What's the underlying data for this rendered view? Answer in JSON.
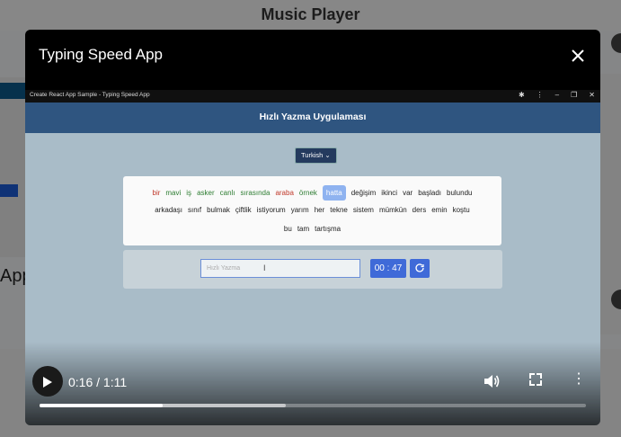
{
  "background": {
    "title": "Music Player",
    "side_text": "App"
  },
  "modal": {
    "title": "Typing Speed App",
    "close_icon": "close-icon"
  },
  "browser": {
    "tab_title": "Create React App Sample - Typing Speed App",
    "icons": [
      "extension-icon",
      "more-vert-icon",
      "minimize-icon",
      "restore-icon",
      "close-icon"
    ]
  },
  "app": {
    "header_title": "Hızlı Yazma Uygulaması",
    "language_selected": "Turkish",
    "words": {
      "row1": [
        {
          "text": "bir",
          "state": "wrong"
        },
        {
          "text": "mavi",
          "state": "right"
        },
        {
          "text": "iş",
          "state": "right"
        },
        {
          "text": "asker",
          "state": "right"
        },
        {
          "text": "canlı",
          "state": "right"
        },
        {
          "text": "sırasında",
          "state": "right"
        },
        {
          "text": "araba",
          "state": "wrong"
        },
        {
          "text": "örnek",
          "state": "right"
        },
        {
          "text": "hatta",
          "state": "current"
        },
        {
          "text": "değişim",
          "state": "pending"
        },
        {
          "text": "ikinci",
          "state": "pending"
        },
        {
          "text": "var",
          "state": "pending"
        },
        {
          "text": "başladı",
          "state": "pending"
        },
        {
          "text": "bulundu",
          "state": "pending"
        }
      ],
      "row2": [
        {
          "text": "arkadaşı",
          "state": "pending"
        },
        {
          "text": "sınıf",
          "state": "pending"
        },
        {
          "text": "bulmak",
          "state": "pending"
        },
        {
          "text": "çiftlik",
          "state": "pending"
        },
        {
          "text": "istiyorum",
          "state": "pending"
        },
        {
          "text": "yarım",
          "state": "pending"
        },
        {
          "text": "her",
          "state": "pending"
        },
        {
          "text": "tekne",
          "state": "pending"
        },
        {
          "text": "sistem",
          "state": "pending"
        },
        {
          "text": "mümkün",
          "state": "pending"
        },
        {
          "text": "ders",
          "state": "pending"
        },
        {
          "text": "emin",
          "state": "pending"
        },
        {
          "text": "koştu",
          "state": "pending"
        }
      ],
      "row3": [
        {
          "text": "bu",
          "state": "pending"
        },
        {
          "text": "tam",
          "state": "pending"
        },
        {
          "text": "tartışma",
          "state": "pending"
        }
      ]
    },
    "input_placeholder": "Hızlı Yazma",
    "timer": "00 : 47",
    "reset_icon": "refresh-icon"
  },
  "player": {
    "time": "0:16 / 1:11",
    "progress_fraction": 0.225,
    "buffered_fraction": 0.45,
    "play_icon": "play-icon",
    "volume_icon": "volume-icon",
    "fullscreen_icon": "fullscreen-icon",
    "more_icon": "more-vert-icon"
  },
  "colors": {
    "header": "#2f5580",
    "accent": "#3f6ad8",
    "word_wrong": "#c0392b",
    "word_right": "#2e7d32",
    "word_current": "#8fb3f0"
  }
}
